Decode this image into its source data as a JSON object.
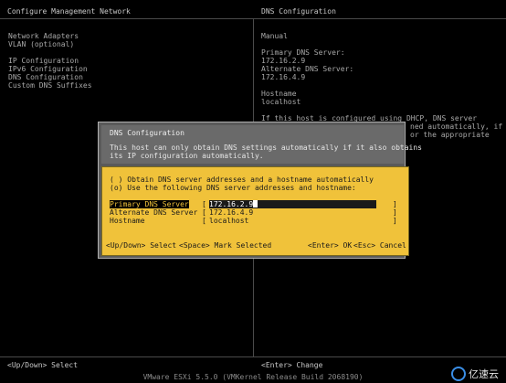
{
  "header": {
    "left_title": "Configure Management Network",
    "right_title": "DNS Configuration"
  },
  "menu": [
    "Network Adapters",
    "VLAN (optional)",
    "",
    "IP Configuration",
    "IPv6 Configuration",
    "DNS Configuration",
    "Custom DNS Suffixes"
  ],
  "right_panel": {
    "mode": "Manual",
    "primary_label": "Primary DNS Server:",
    "primary_value": "172.16.2.9",
    "alternate_label": "Alternate DNS Server:",
    "alternate_value": "172.16.4.9",
    "hostname_label": "Hostname",
    "hostname_value": "localhost",
    "info_line1": "If this host is configured using DHCP, DNS server addresses",
    "info_line2": "ned automatically, if",
    "info_line3": "or the appropriate"
  },
  "dialog": {
    "title": "DNS Configuration",
    "desc_line1": "This host can only obtain DNS settings automatically if it also obtains",
    "desc_line2": "its IP configuration automatically.",
    "option_auto": "( ) Obtain DNS server addresses and a hostname automatically",
    "option_manual": "(o) Use the following DNS server addresses and hostname:",
    "fields": {
      "primary_label": "Primary DNS Server",
      "primary_value": "172.16.2.9",
      "alternate_label": "Alternate DNS Server",
      "alternate_value": "172.16.4.9",
      "hostname_label": "Hostname",
      "hostname_value": "localhost"
    },
    "footer": {
      "updown_key": "<Up/Down>",
      "updown_action": "Select",
      "space_key": "<Space>",
      "space_action": "Mark Selected",
      "enter_key": "<Enter>",
      "enter_action": "OK",
      "esc_key": "<Esc>",
      "esc_action": "Cancel"
    }
  },
  "footer": {
    "left": "<Up/Down> Select",
    "right": "<Enter> Change",
    "version": "VMware ESXi 5.5.0 (VMKernel Release Build 2068190)"
  },
  "watermark": {
    "text": "亿速云",
    "icon": "cloud-logo-icon"
  }
}
